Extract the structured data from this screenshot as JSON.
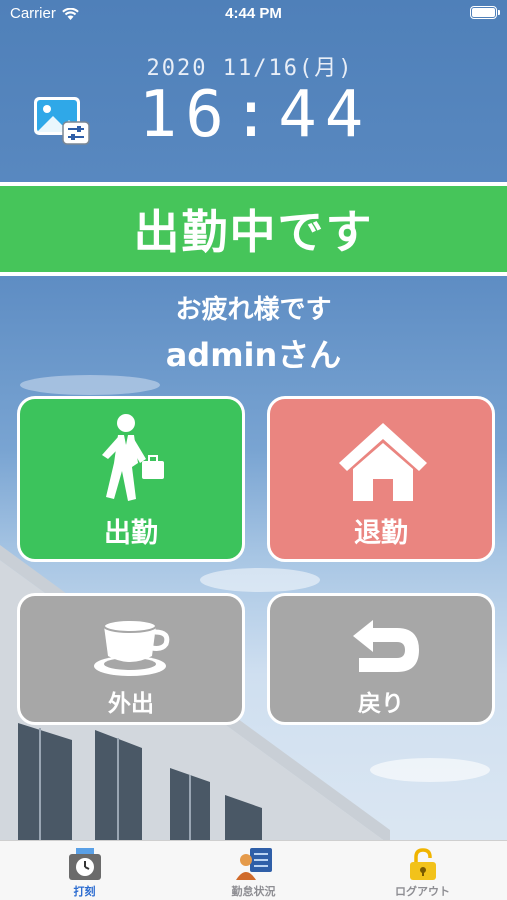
{
  "status_bar": {
    "carrier": "Carrier",
    "time": "4:44 PM"
  },
  "header": {
    "date": "2020 11/16(月)",
    "time": "16:44"
  },
  "status_banner": {
    "text": "出勤中です",
    "color": "#46c55a"
  },
  "greeting": {
    "line1": "お疲れ様です",
    "line2": "adminさん"
  },
  "buttons": {
    "clock_in": {
      "label": "出勤",
      "icon": "businessman-walking-icon",
      "color": "#3cc35c"
    },
    "clock_out": {
      "label": "退勤",
      "icon": "house-icon",
      "color": "#ea8580"
    },
    "go_out": {
      "label": "外出",
      "icon": "coffee-cup-icon",
      "color": "#a7a7a7"
    },
    "return": {
      "label": "戻り",
      "icon": "return-arrow-icon",
      "color": "#a7a7a7"
    }
  },
  "tab_bar": {
    "tabs": [
      {
        "label": "打刻",
        "icon": "punch-clock-icon",
        "active": true
      },
      {
        "label": "勤怠状況",
        "icon": "attendance-status-icon",
        "active": false
      },
      {
        "label": "ログアウト",
        "icon": "padlock-icon",
        "active": false
      }
    ],
    "active_color": "#2c6cd0"
  }
}
